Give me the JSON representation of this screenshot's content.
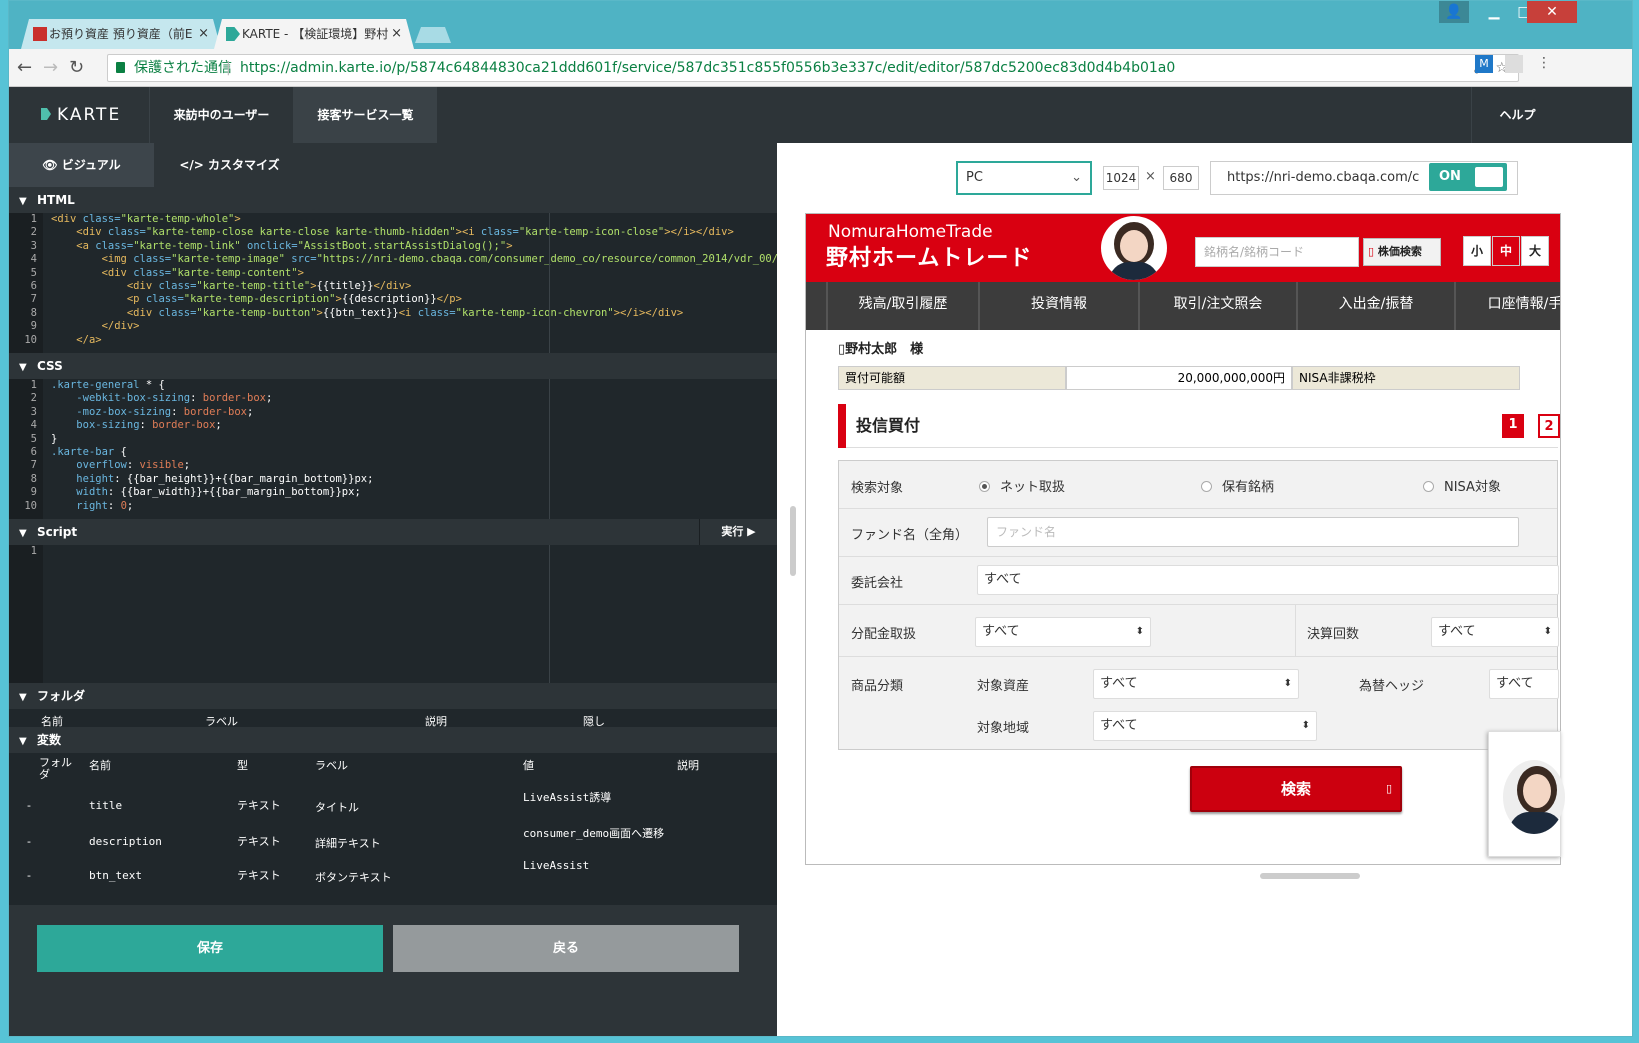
{
  "browser": {
    "tabs": [
      {
        "label": "お預り資産 預り資産（前E",
        "close": "×"
      },
      {
        "label": "KARTE - 【検証環境】野村",
        "close": "×"
      }
    ],
    "secure_label": "保護された通信",
    "url": "https://admin.karte.io/p/5874c64844830ca21ddd601f/service/587dc351c855f0556b3e337c/edit/editor/587dc5200ec83d0d4b4b01a0"
  },
  "appnav": {
    "brand": "KARTE",
    "items": [
      "来訪中のユーザー",
      "接客サービス一覧"
    ],
    "help": "ヘルプ"
  },
  "editor": {
    "modes": [
      "👁 ビジュアル",
      "</> カスタマイズ"
    ],
    "html_label": "HTML",
    "css_label": "CSS",
    "script_label": "Script",
    "run_label": "実行 ▶",
    "folder_label": "フォルダ",
    "folder_columns": [
      "名前",
      "ラベル",
      "説明",
      "隠し"
    ],
    "vars_label": "変数",
    "vars_columns": [
      "フォルダ",
      "名前",
      "型",
      "ラベル",
      "値",
      "説明"
    ],
    "vars_rows": [
      {
        "folder": "-",
        "name": "title",
        "type": "テキスト",
        "label": "タイトル",
        "value": "LiveAssist誘導"
      },
      {
        "folder": "-",
        "name": "description",
        "type": "テキスト",
        "label": "詳細テキスト",
        "value": "consumer_demo画面へ遷移"
      },
      {
        "folder": "-",
        "name": "btn_text",
        "type": "テキスト",
        "label": "ボタンテキスト",
        "value": "LiveAssist"
      }
    ],
    "save": "保存",
    "back": "戻る"
  },
  "preview": {
    "device": "PC",
    "width": "1024",
    "times": "×",
    "height": "680",
    "url": "https://nri-demo.cbaqa.com/c",
    "toggle": "ON"
  },
  "site": {
    "logo_en": "NomuraHomeTrade",
    "logo_jp": "野村ホームトレード",
    "search_placeholder": "銘柄名/銘柄コード",
    "search_btn": "株価検索",
    "font_sizes": [
      "小",
      "中",
      "大"
    ],
    "menu": [
      "残高/取引履歴",
      "投資情報",
      "取引/注文照会",
      "入出金/振替",
      "口座情報/手"
    ],
    "user": "野村太郎　様",
    "buy_label": "買付可能額",
    "buy_value": "20,000,000,000円",
    "nisa_label": "NISA非課税枠",
    "section_title": "投信買付",
    "steps": [
      "1",
      "2"
    ],
    "search_target_label": "検索対象",
    "radios": [
      "ネット取扱",
      "保有銘柄",
      "NISA対象"
    ],
    "fund_label": "ファンド名（全角）",
    "fund_placeholder": "ファンド名",
    "trust_label": "委託会社",
    "all": "すべて",
    "dist_label": "分配金取扱",
    "settle_label": "決算回数",
    "product_label": "商品分類",
    "asset_label": "対象資産",
    "hedge_label": "為替ヘッジ",
    "region_label": "対象地域",
    "search_button": "検索"
  }
}
